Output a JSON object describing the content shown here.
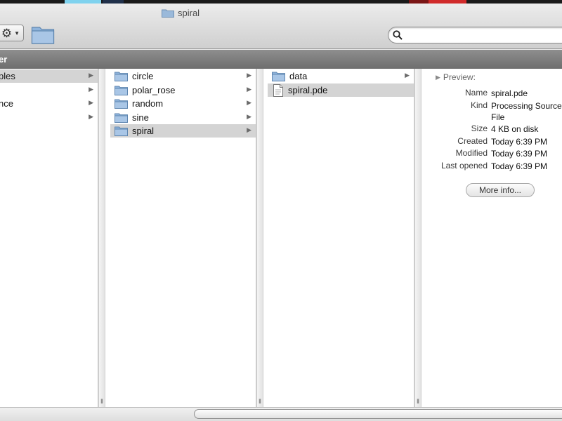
{
  "window": {
    "title": "spiral"
  },
  "pathbar": {
    "text": "er"
  },
  "colors": {
    "selection": "#d4d4d4",
    "folder": "#8fb4dc",
    "pathbar": "#7d7d7d"
  },
  "icons": {
    "action": "gear-icon",
    "folder": "folder-icon",
    "search": "search-icon",
    "file": "document-icon"
  },
  "column1": {
    "items": [
      {
        "label": "ples",
        "selected": true
      },
      {
        "label": "",
        "selected": false
      },
      {
        "label": "nce",
        "selected": false
      },
      {
        "label": "",
        "selected": false
      }
    ]
  },
  "column2": {
    "items": [
      {
        "label": "circle"
      },
      {
        "label": "polar_rose"
      },
      {
        "label": "random"
      },
      {
        "label": "sine"
      },
      {
        "label": "spiral",
        "selected": true
      }
    ]
  },
  "column3": {
    "items": [
      {
        "label": "data",
        "type": "folder"
      },
      {
        "label": "spiral.pde",
        "type": "file",
        "selected": true
      }
    ]
  },
  "preview": {
    "header": "Preview:",
    "fields": [
      {
        "key": "Name",
        "value": "spiral.pde"
      },
      {
        "key": "Kind",
        "value": "Processing Source",
        "value2": "File"
      },
      {
        "key": "Size",
        "value": "4 KB on disk"
      },
      {
        "key": "Created",
        "value": "Today 6:39 PM"
      },
      {
        "key": "Modified",
        "value": "Today 6:39 PM"
      },
      {
        "key": "Last opened",
        "value": "Today 6:39 PM"
      }
    ],
    "more_button": "More info..."
  },
  "grip_symbol": "II",
  "arrow_symbol": "▶"
}
